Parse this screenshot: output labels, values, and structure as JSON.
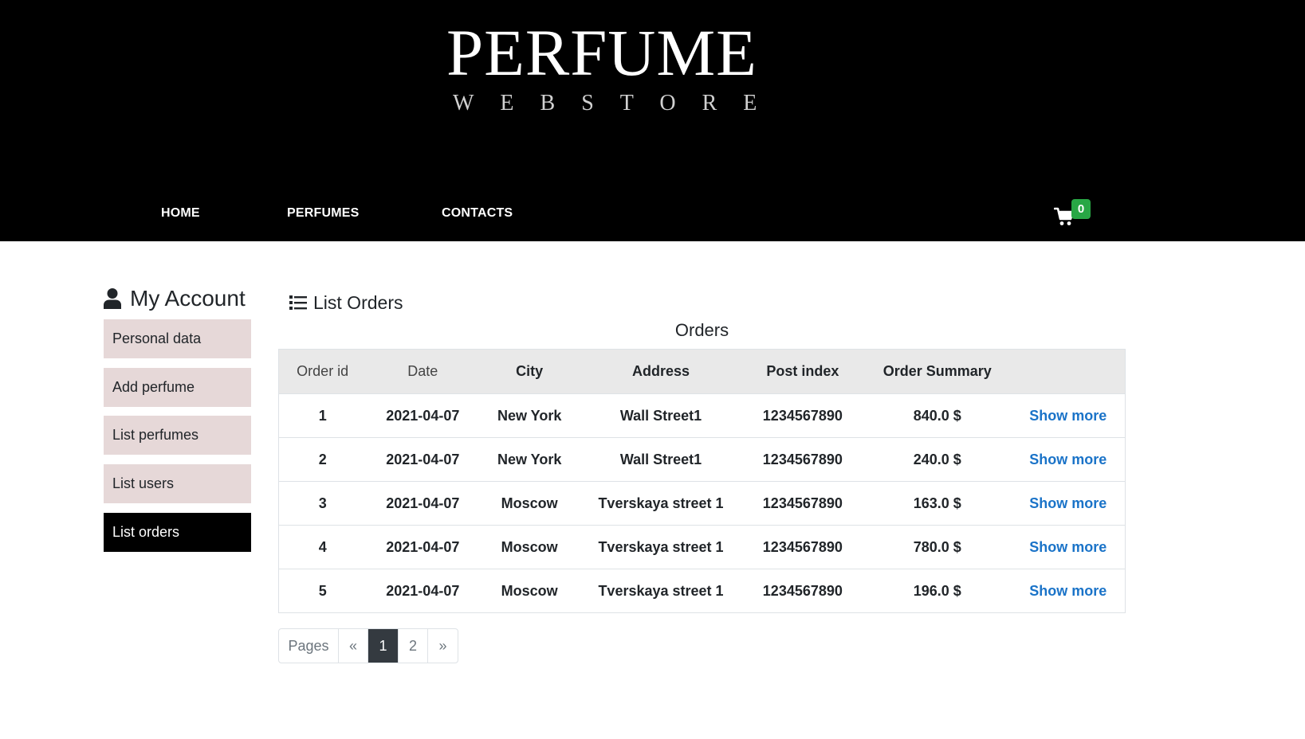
{
  "logo": {
    "main": "PERFUME",
    "sub": "WEBSTORE"
  },
  "nav": {
    "home": "HOME",
    "perfumes": "PERFUMES",
    "contacts": "CONTACTS"
  },
  "cart": {
    "count": "0",
    "badge_color": "#28a745"
  },
  "sidebar": {
    "title": "My Account",
    "items": [
      {
        "label": "Personal data"
      },
      {
        "label": "Add perfume"
      },
      {
        "label": "List perfumes"
      },
      {
        "label": "List users"
      },
      {
        "label": "List orders",
        "active": true
      }
    ]
  },
  "main": {
    "title": "List Orders",
    "table_caption": "Orders",
    "columns": [
      "Order id",
      "Date",
      "City",
      "Address",
      "Post index",
      "Order Summary",
      ""
    ],
    "rows": [
      {
        "id": "1",
        "date": "2021-04-07",
        "city": "New York",
        "address": "Wall Street1",
        "post_index": "1234567890",
        "summary": "840.0 $",
        "action": "Show more"
      },
      {
        "id": "2",
        "date": "2021-04-07",
        "city": "New York",
        "address": "Wall Street1",
        "post_index": "1234567890",
        "summary": "240.0 $",
        "action": "Show more"
      },
      {
        "id": "3",
        "date": "2021-04-07",
        "city": "Moscow",
        "address": "Tverskaya street 1",
        "post_index": "1234567890",
        "summary": "163.0 $",
        "action": "Show more"
      },
      {
        "id": "4",
        "date": "2021-04-07",
        "city": "Moscow",
        "address": "Tverskaya street 1",
        "post_index": "1234567890",
        "summary": "780.0 $",
        "action": "Show more"
      },
      {
        "id": "5",
        "date": "2021-04-07",
        "city": "Moscow",
        "address": "Tverskaya street 1",
        "post_index": "1234567890",
        "summary": "196.0 $",
        "action": "Show more"
      }
    ]
  },
  "pagination": {
    "label": "Pages",
    "prev": "«",
    "pages": [
      "1",
      "2"
    ],
    "current": "1",
    "next": "»"
  },
  "colors": {
    "header_bg": "#000000",
    "sidebar_item_bg": "#e6d8d8",
    "link": "#1a73c8",
    "active_page_bg": "#343a40"
  }
}
